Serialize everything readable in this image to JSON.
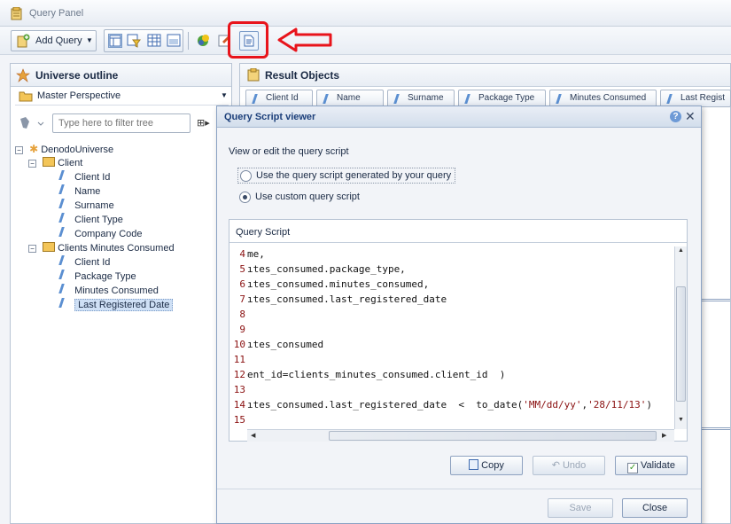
{
  "window": {
    "title": "Query Panel"
  },
  "toolbar": {
    "add_query_label": "Add Query"
  },
  "universe_outline": {
    "header": "Universe outline",
    "perspective": "Master Perspective",
    "filter_placeholder": "Type here to filter tree",
    "tree": {
      "root": "DenodoUniverse",
      "folders": [
        {
          "label": "Client",
          "items": [
            "Client Id",
            "Name",
            "Surname",
            "Client Type",
            "Company Code"
          ]
        },
        {
          "label": "Clients Minutes Consumed",
          "items": [
            "Client Id",
            "Package Type",
            "Minutes Consumed",
            "Last Registered Date"
          ]
        }
      ],
      "selected": "Last Registered Date"
    }
  },
  "result_objects": {
    "header": "Result Objects",
    "columns": [
      "Client Id",
      "Name",
      "Surname",
      "Package Type",
      "Minutes Consumed",
      "Last Regist"
    ]
  },
  "dialog": {
    "title": "Query Script viewer",
    "instruction": "View or edit the query script",
    "options": [
      {
        "label": "Use the query script generated by your query",
        "checked": false
      },
      {
        "label": "Use custom query script",
        "checked": true
      }
    ],
    "script_header": "Query Script",
    "lines": [
      {
        "num": "4",
        "text": "me,"
      },
      {
        "num": "5",
        "text": "ıtes_consumed.package_type,"
      },
      {
        "num": "6",
        "text": "ıtes_consumed.minutes_consumed,"
      },
      {
        "num": "7",
        "text": "ıtes_consumed.last_registered_date"
      },
      {
        "num": "8",
        "text": ""
      },
      {
        "num": "9",
        "text": ""
      },
      {
        "num": "10",
        "text": "ıtes_consumed"
      },
      {
        "num": "11",
        "text": ""
      },
      {
        "num": "12",
        "text": "ent_id=clients_minutes_consumed.client_id  )"
      },
      {
        "num": "13",
        "text": ""
      },
      {
        "num": "14",
        "text": "ıtes_consumed.last_registered_date  <  to_date('MM/dd/yy','28/11/13')"
      },
      {
        "num": "15",
        "text": ""
      }
    ],
    "buttons": {
      "copy": "Copy",
      "undo": "Undo",
      "validate": "Validate",
      "save": "Save",
      "close": "Close"
    }
  },
  "colors": {
    "accent": "#e8141b",
    "selection": "#cfe0f5",
    "dialog_title": "#1c3f7a"
  },
  "icons": [
    "query-panel-icon",
    "add-query-icon",
    "universe-icon",
    "perspective-icon",
    "filter-icon",
    "folder-icon",
    "object-icon",
    "result-objects-icon",
    "help-icon",
    "close-icon",
    "copy-icon",
    "undo-icon",
    "validate-icon",
    "query-script-icon"
  ]
}
